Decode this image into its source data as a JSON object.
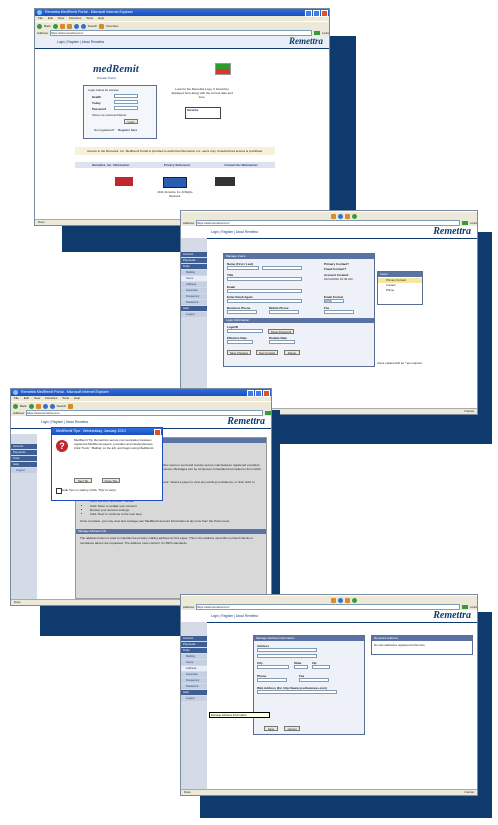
{
  "browser": {
    "window_title": "Remettra MedRemit Portal - Microsoft Internet Explorer",
    "menu": [
      "File",
      "Edit",
      "View",
      "Favorites",
      "Tools",
      "Help"
    ],
    "back_label": "Back",
    "search_label": "Search",
    "favorites_label": "Favorites",
    "address_label": "Address",
    "address_value": "https://www.remettra.com/",
    "go_label": "Go",
    "links_label": "Links",
    "status_done": "Done",
    "status_zone": "Internet"
  },
  "site": {
    "logo": "Remettra",
    "nav": "Login | Register | About Remettra"
  },
  "screen1": {
    "app_logo": "medRemit",
    "app_subtitle": "Provider Portal",
    "login_heading": "Login below for access.",
    "health_label": "Health",
    "today_label": "Today",
    "password_label": "Password",
    "show_me_label": "Show me result and Enter",
    "login_button": "Login",
    "not_registered": "Not registered?",
    "register_link": "Register here",
    "notice": "Look for the Remettra Logo. It should be displayed here along with the current date and time.",
    "access_text": "Access to the Remettra, Inc. MedRemit Portal is provided to authorized Remettra, Inc. users only. Unauthorized access is prohibited.",
    "footer_links": [
      "Remettra, Inc. Information",
      "Privacy Statement",
      "Contact the Webmaster"
    ],
    "copyright": "2010, Remettra, Inc. All Rights Reserved."
  },
  "sidebar": {
    "items": [
      "Account",
      "Payments",
      "Tools",
      "Help",
      "Logout"
    ],
    "sub_items": [
      "Mailing",
      "Users",
      "Address",
      "Accounts",
      "Frequency",
      "Password"
    ]
  },
  "screen2": {
    "panel_title": "Manage Users",
    "first_label": "Name (First / Last)",
    "primary_contact": "Primary Contact?",
    "fraud_contact": "Fraud Contact?",
    "title_label": "Title",
    "account_created": "Account Created:",
    "account_created_value": "01/14/2010 10:36 AM",
    "email_label": "Email",
    "confirm_email_label": "Enter Email Again",
    "email_format_label": "Email Format",
    "email_format_value": "HTML",
    "business_phone": "Business Phone",
    "mobile_phone": "Mobile Phone",
    "fax_label": "Fax",
    "login_section": "Login Information",
    "login_id_label": "LoginID",
    "reset_password": "Reset Password",
    "effective_date": "Effective Date",
    "disable_date": "Disable Date",
    "save_button": "Save Changes",
    "new_button": "New Contact",
    "delete_button": "Delete",
    "users_header": "Users",
    "user_rows": [
      "Primary Contact",
      "Contact",
      "Phone"
    ],
    "note": "Users marked with an * are required"
  },
  "screen3": {
    "dialog_title": "MedRemit Tips - Wednesday, January 2010",
    "dialog_text": "MedRemit Tip. Remettra's secure communication between registered MedRemit payers, providers and clearinghouses. Click 'Tools', 'Mailing' on the left, and begin using MedRemit.",
    "next_tip": "Next Tip",
    "close_tip": "Close Tips",
    "checkbox_label": "Hide Tips on startup (Click 'Tips' to view)",
    "content_title": "Getting Started with MedRemit Mailing",
    "para1": "The Mailing tool enables users to send and receive secure mail between registered providers, payers and clearinghouses. Messages can be composed, forwarded and replied to from within the MedRemit portal.",
    "para2": "To set up an account, click 'Tools' on the left and choose 'Accounts'. Select a payer to view any existing remittances, or click 'Add' to create a new one.",
    "steps": [
      "Choose MedRemit Account",
      "Payer/Remitter (Remettra) 'Contact'",
      "Fill in the form, and click 'Contact'",
      "Click 'Save' to update your account",
      "Review your account settings",
      "Click 'Next' to continue to the next step"
    ],
    "para3": "Once complete, you may view and manage your MedRemit account information at any time from the Tools menu.",
    "section_title": "Manage Address Info",
    "para4": "The address button is used to maintain the primary mailing address for this payer. This is the address used when printed checks or remittance advice are requested. The address must conform to USPS standards."
  },
  "screen4": {
    "panel_title": "Manage Address Information",
    "address_label": "Address",
    "city_label": "City",
    "state_label": "State",
    "zip_label": "Zip",
    "phone_label": "Phone",
    "fax_label": "Fax",
    "web_label": "Web Address (Ex: http://www.yourbusiness.com)",
    "save_button": "Save",
    "cancel_button": "Cancel",
    "help_header": "Remettra Address",
    "help_text": "No new addresses registered at this time.",
    "tooltip": "Manage Address Information"
  }
}
